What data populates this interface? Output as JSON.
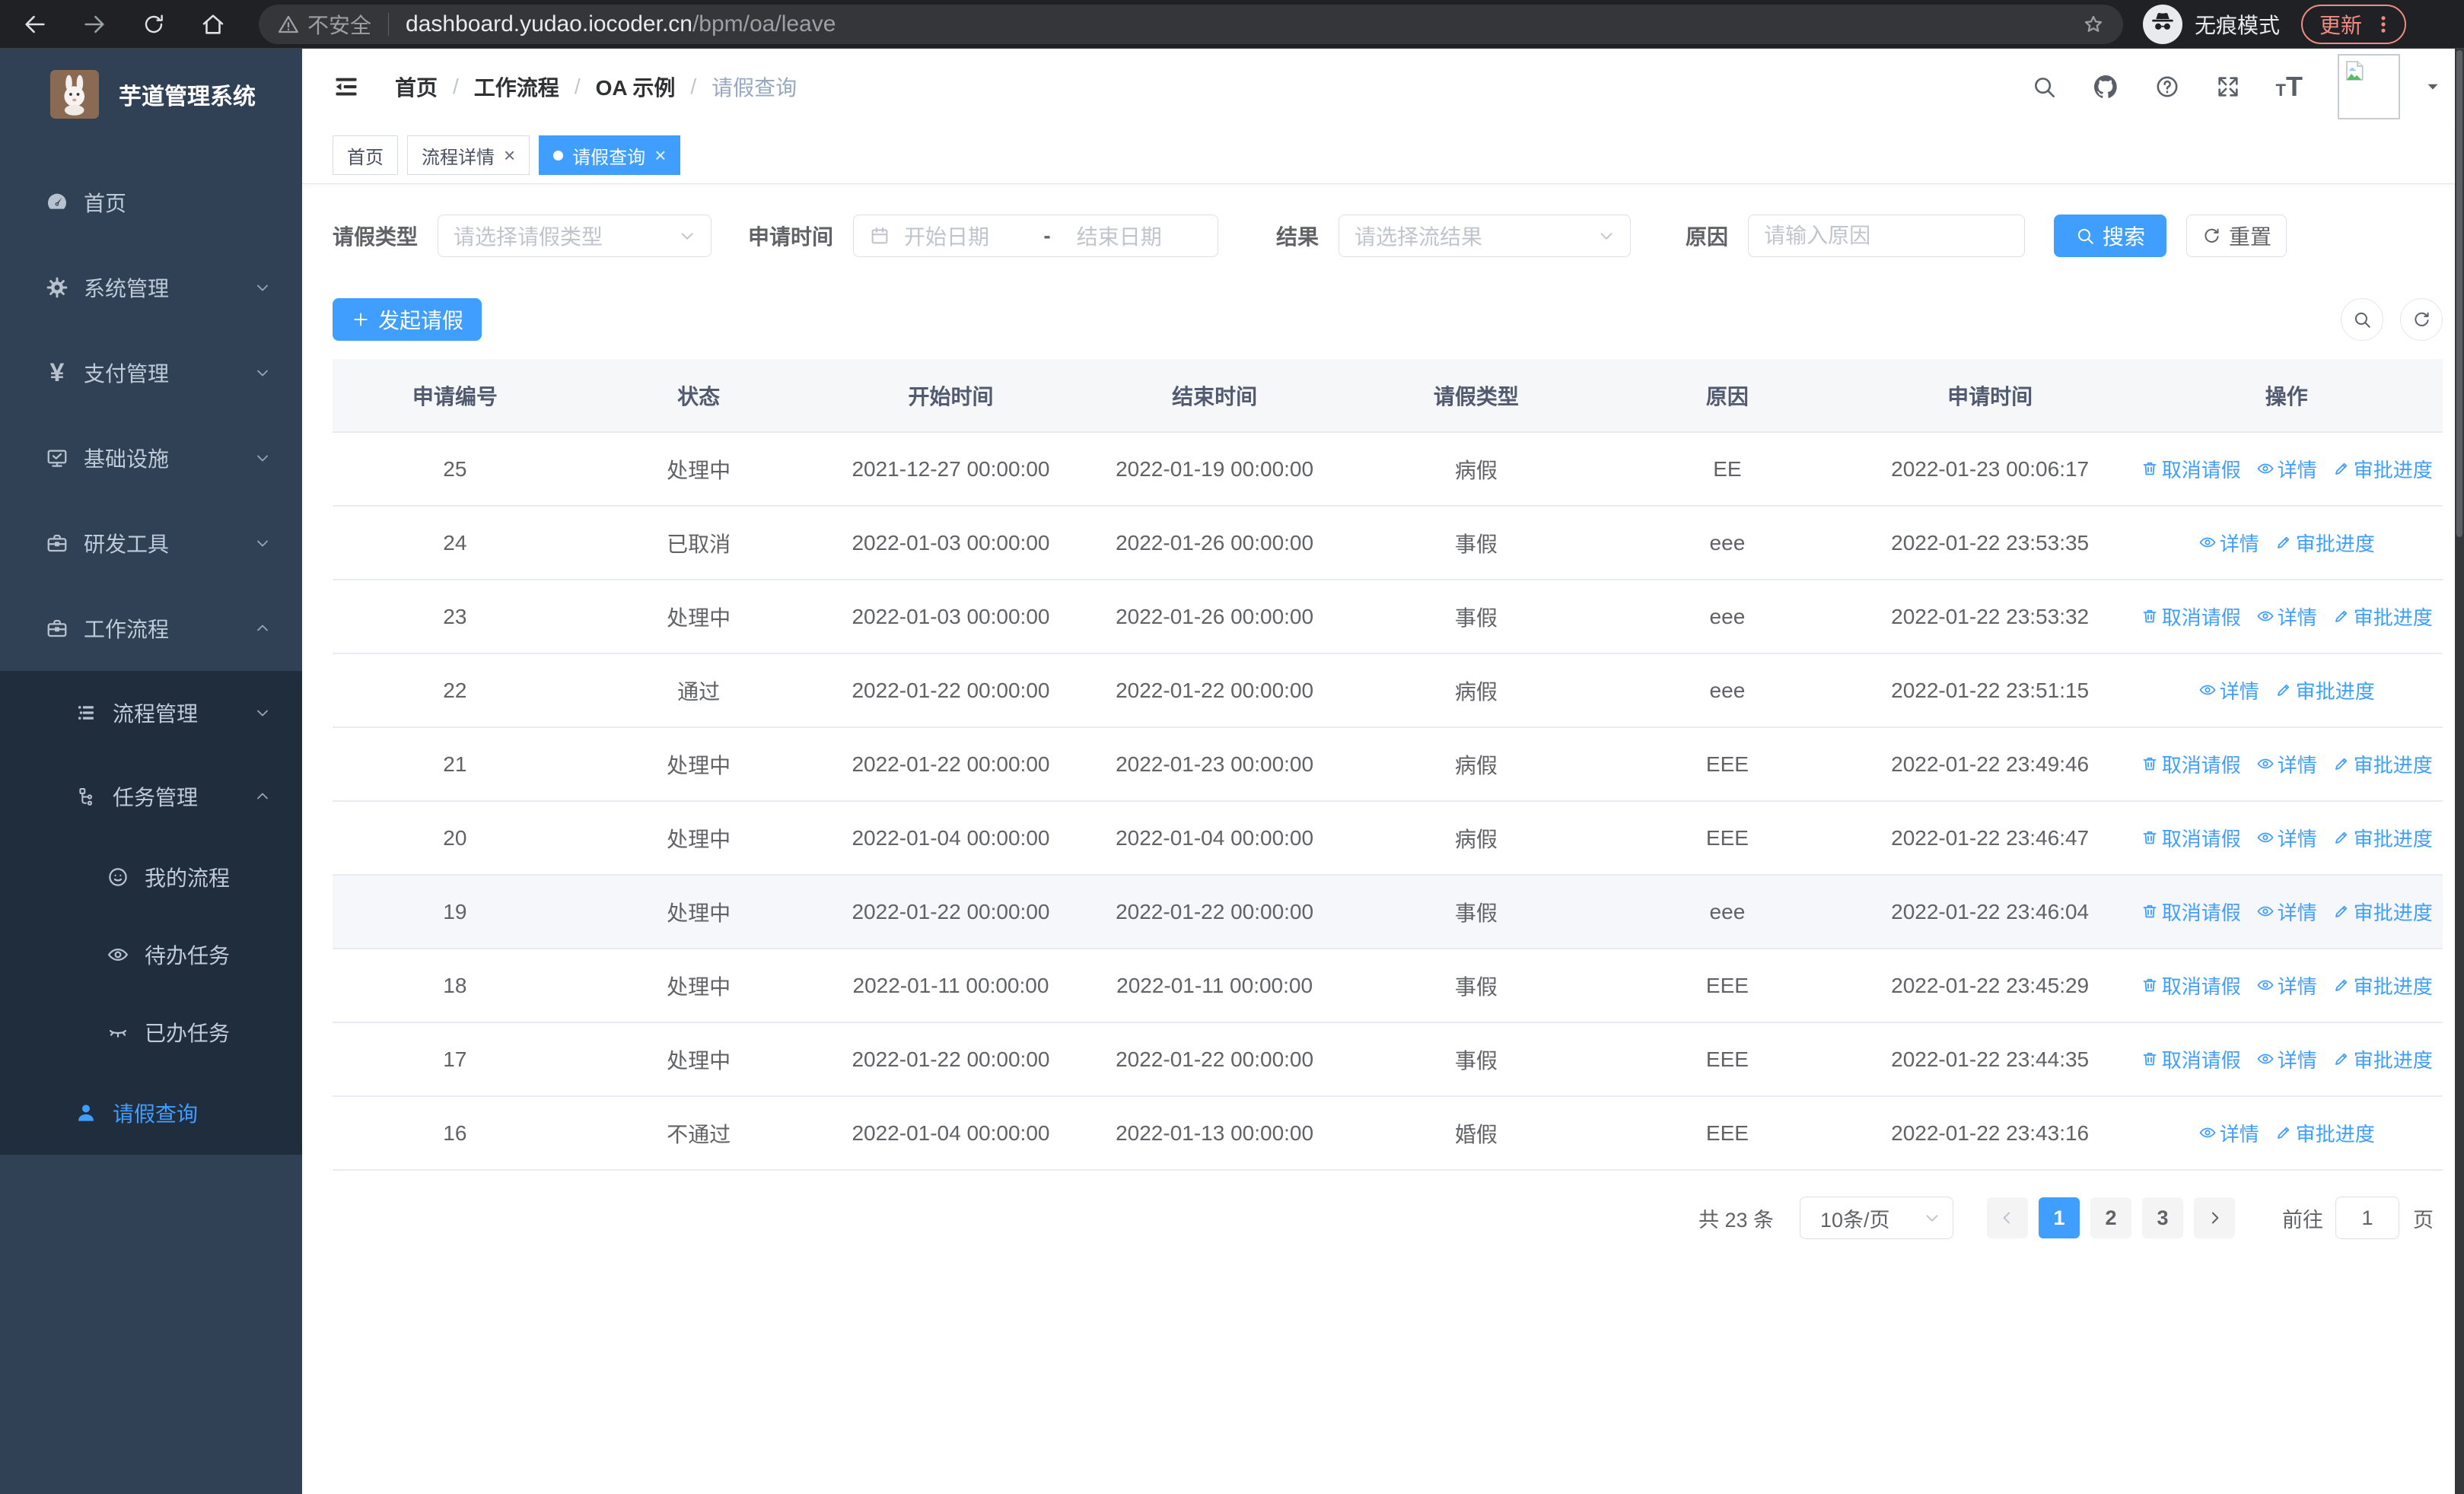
{
  "browser": {
    "security_warning": "不安全",
    "url_domain": "dashboard.yudao.iocoder.cn",
    "url_path": "/bpm/oa/leave",
    "incognito_label": "无痕模式",
    "update_label": "更新"
  },
  "sidebar": {
    "title": "芋道管理系统",
    "items": [
      {
        "id": "home",
        "icon": "dashboard-icon",
        "label": "首页",
        "level": 0
      },
      {
        "id": "system-mgmt",
        "icon": "gear-icon",
        "label": "系统管理",
        "level": 0,
        "chevron": "down"
      },
      {
        "id": "payment-mgmt",
        "icon": "yen-icon",
        "label": "支付管理",
        "level": 0,
        "chevron": "down"
      },
      {
        "id": "infrastructure",
        "icon": "monitor-icon",
        "label": "基础设施",
        "level": 0,
        "chevron": "down"
      },
      {
        "id": "dev-tools",
        "icon": "toolbox-icon",
        "label": "研发工具",
        "level": 0,
        "chevron": "down"
      },
      {
        "id": "workflow",
        "icon": "briefcase-icon",
        "label": "工作流程",
        "level": 0,
        "chevron": "up"
      },
      {
        "id": "process-mgmt",
        "icon": "tree-list-icon",
        "label": "流程管理",
        "level": 1,
        "chevron": "down",
        "group": true
      },
      {
        "id": "task-mgmt",
        "icon": "org-chart-icon",
        "label": "任务管理",
        "level": 1,
        "chevron": "up",
        "group": true
      },
      {
        "id": "my-process",
        "icon": "face-icon",
        "label": "我的流程",
        "level": 2,
        "group": true
      },
      {
        "id": "todo-tasks",
        "icon": "eye-icon",
        "label": "待办任务",
        "level": 2,
        "group": true
      },
      {
        "id": "done-tasks",
        "icon": "eye-closed-icon",
        "label": "已办任务",
        "level": 2,
        "group": true
      },
      {
        "id": "leave-query",
        "icon": "person-icon",
        "label": "请假查询",
        "level": 1,
        "group": true,
        "active": true
      }
    ]
  },
  "header": {
    "breadcrumb": [
      "首页",
      "工作流程",
      "OA 示例",
      "请假查询"
    ]
  },
  "tabs": [
    {
      "id": "home",
      "label": "首页"
    },
    {
      "id": "process-detail",
      "label": "流程详情",
      "closable": true
    },
    {
      "id": "leave-query",
      "label": "请假查询",
      "closable": true,
      "active": true
    }
  ],
  "filters": {
    "leave_type_label": "请假类型",
    "leave_type_placeholder": "请选择请假类型",
    "apply_time_label": "申请时间",
    "date_start_placeholder": "开始日期",
    "date_separator": "-",
    "date_end_placeholder": "结束日期",
    "result_label": "结果",
    "result_placeholder": "请选择流结果",
    "reason_label": "原因",
    "reason_placeholder": "请输入原因",
    "search_button": "搜索",
    "reset_button": "重置"
  },
  "toolbar": {
    "create_button": "发起请假"
  },
  "table": {
    "columns": [
      "申请编号",
      "状态",
      "开始时间",
      "结束时间",
      "请假类型",
      "原因",
      "申请时间",
      "操作"
    ],
    "action_labels": {
      "cancel": "取消请假",
      "detail": "详情",
      "progress": "审批进度"
    },
    "rows": [
      {
        "id": "25",
        "status": "处理中",
        "start": "2021-12-27 00:00:00",
        "end": "2022-01-19 00:00:00",
        "type": "病假",
        "reason": "EE",
        "applied": "2022-01-23 00:06:17",
        "actions": [
          "cancel",
          "detail",
          "progress"
        ]
      },
      {
        "id": "24",
        "status": "已取消",
        "start": "2022-01-03 00:00:00",
        "end": "2022-01-26 00:00:00",
        "type": "事假",
        "reason": "eee",
        "applied": "2022-01-22 23:53:35",
        "actions": [
          "detail",
          "progress"
        ]
      },
      {
        "id": "23",
        "status": "处理中",
        "start": "2022-01-03 00:00:00",
        "end": "2022-01-26 00:00:00",
        "type": "事假",
        "reason": "eee",
        "applied": "2022-01-22 23:53:32",
        "actions": [
          "cancel",
          "detail",
          "progress"
        ]
      },
      {
        "id": "22",
        "status": "通过",
        "start": "2022-01-22 00:00:00",
        "end": "2022-01-22 00:00:00",
        "type": "病假",
        "reason": "eee",
        "applied": "2022-01-22 23:51:15",
        "actions": [
          "detail",
          "progress"
        ]
      },
      {
        "id": "21",
        "status": "处理中",
        "start": "2022-01-22 00:00:00",
        "end": "2022-01-23 00:00:00",
        "type": "病假",
        "reason": "EEE",
        "applied": "2022-01-22 23:49:46",
        "actions": [
          "cancel",
          "detail",
          "progress"
        ]
      },
      {
        "id": "20",
        "status": "处理中",
        "start": "2022-01-04 00:00:00",
        "end": "2022-01-04 00:00:00",
        "type": "病假",
        "reason": "EEE",
        "applied": "2022-01-22 23:46:47",
        "actions": [
          "cancel",
          "detail",
          "progress"
        ]
      },
      {
        "id": "19",
        "status": "处理中",
        "start": "2022-01-22 00:00:00",
        "end": "2022-01-22 00:00:00",
        "type": "事假",
        "reason": "eee",
        "applied": "2022-01-22 23:46:04",
        "actions": [
          "cancel",
          "detail",
          "progress"
        ],
        "highlight": true
      },
      {
        "id": "18",
        "status": "处理中",
        "start": "2022-01-11 00:00:00",
        "end": "2022-01-11 00:00:00",
        "type": "事假",
        "reason": "EEE",
        "applied": "2022-01-22 23:45:29",
        "actions": [
          "cancel",
          "detail",
          "progress"
        ]
      },
      {
        "id": "17",
        "status": "处理中",
        "start": "2022-01-22 00:00:00",
        "end": "2022-01-22 00:00:00",
        "type": "事假",
        "reason": "EEE",
        "applied": "2022-01-22 23:44:35",
        "actions": [
          "cancel",
          "detail",
          "progress"
        ]
      },
      {
        "id": "16",
        "status": "不通过",
        "start": "2022-01-04 00:00:00",
        "end": "2022-01-13 00:00:00",
        "type": "婚假",
        "reason": "EEE",
        "applied": "2022-01-22 23:43:16",
        "actions": [
          "detail",
          "progress"
        ]
      }
    ]
  },
  "pagination": {
    "total": "共 23 条",
    "page_size": "10条/页",
    "pages": [
      "1",
      "2",
      "3"
    ],
    "active_page": "1",
    "goto_label": "前往",
    "goto_value": "1",
    "goto_suffix": "页"
  },
  "colors": {
    "primary": "#409eff",
    "sidebar_bg": "#304156",
    "submenu_bg": "#1f2d3d",
    "active_tab_bg": "#409eff"
  }
}
